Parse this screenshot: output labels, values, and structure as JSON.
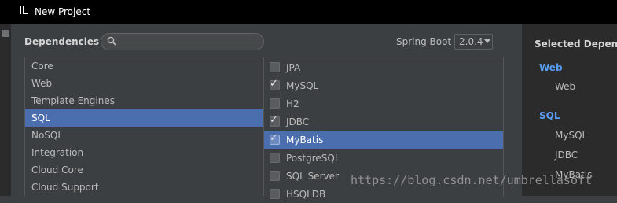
{
  "window": {
    "title": "New Project"
  },
  "dependencies": {
    "label": "Dependencies",
    "search_placeholder": "",
    "spring_boot_label": "Spring Boot",
    "spring_boot_version": "2.0.4"
  },
  "categories": [
    {
      "label": "Core",
      "selected": false
    },
    {
      "label": "Web",
      "selected": false
    },
    {
      "label": "Template Engines",
      "selected": false
    },
    {
      "label": "SQL",
      "selected": true
    },
    {
      "label": "NoSQL",
      "selected": false
    },
    {
      "label": "Integration",
      "selected": false
    },
    {
      "label": "Cloud Core",
      "selected": false
    },
    {
      "label": "Cloud Support",
      "selected": false
    }
  ],
  "options": [
    {
      "label": "JPA",
      "checked": false,
      "selected": false
    },
    {
      "label": "MySQL",
      "checked": true,
      "selected": false
    },
    {
      "label": "H2",
      "checked": false,
      "selected": false
    },
    {
      "label": "JDBC",
      "checked": true,
      "selected": false
    },
    {
      "label": "MyBatis",
      "checked": true,
      "selected": true
    },
    {
      "label": "PostgreSQL",
      "checked": false,
      "selected": false
    },
    {
      "label": "SQL Server",
      "checked": false,
      "selected": false
    },
    {
      "label": "HSQLDB",
      "checked": false,
      "selected": false
    }
  ],
  "selected_dependencies": {
    "title": "Selected Dependencies",
    "groups": [
      {
        "name": "Web",
        "items": [
          "Web"
        ]
      },
      {
        "name": "SQL",
        "items": [
          "MySQL",
          "JDBC",
          "MyBatis"
        ]
      }
    ]
  },
  "watermark": "https://blog.csdn.net/umbrellasoft",
  "colors": {
    "selection": "#4b6eaf",
    "group_header": "#589df6",
    "background": "#3c3f41"
  }
}
